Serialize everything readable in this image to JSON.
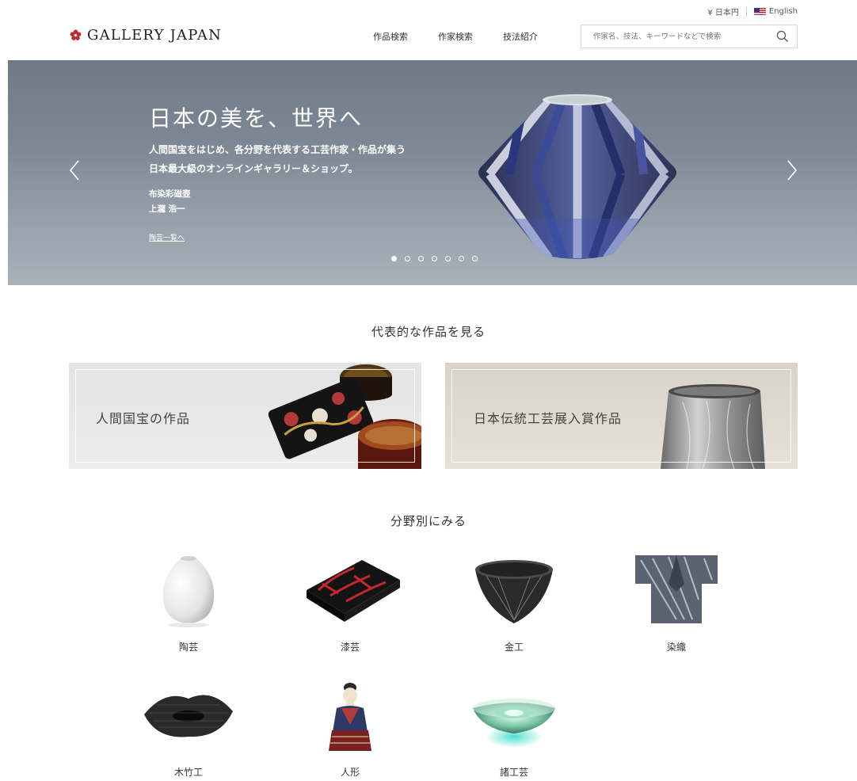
{
  "header": {
    "currency": "¥ 日本円",
    "language": "English",
    "logo": "GALLERY JAPAN",
    "nav": [
      "作品検索",
      "作家検索",
      "技法紹介"
    ],
    "search_placeholder": "作家名、技法、キーワードなどで検索"
  },
  "hero": {
    "title": "日本の美を、世界へ",
    "subtitle_line1": "人間国宝をはじめ、各分野を代表する工芸作家・作品が集う",
    "subtitle_line2": "日本最大級のオンラインギャラリー＆ショップ。",
    "work_title": "布染彩磁壺",
    "artist": "上瀧 浩一",
    "link": "陶芸一覧へ",
    "slide_count": 7,
    "active_slide": 1
  },
  "featured": {
    "title": "代表的な作品を見る",
    "cards": [
      {
        "label": "人間国宝の作品"
      },
      {
        "label": "日本伝統工芸展入賞作品"
      }
    ]
  },
  "categories": {
    "title": "分野別にみる",
    "items": [
      {
        "label": "陶芸"
      },
      {
        "label": "漆芸"
      },
      {
        "label": "金工"
      },
      {
        "label": "染織"
      },
      {
        "label": "木竹工"
      },
      {
        "label": "人形"
      },
      {
        "label": "諸工芸"
      }
    ]
  },
  "colors": {
    "brand_red": "#c0282d",
    "hero_top": "#6f7a87",
    "hero_bottom": "#a9b1b9"
  }
}
